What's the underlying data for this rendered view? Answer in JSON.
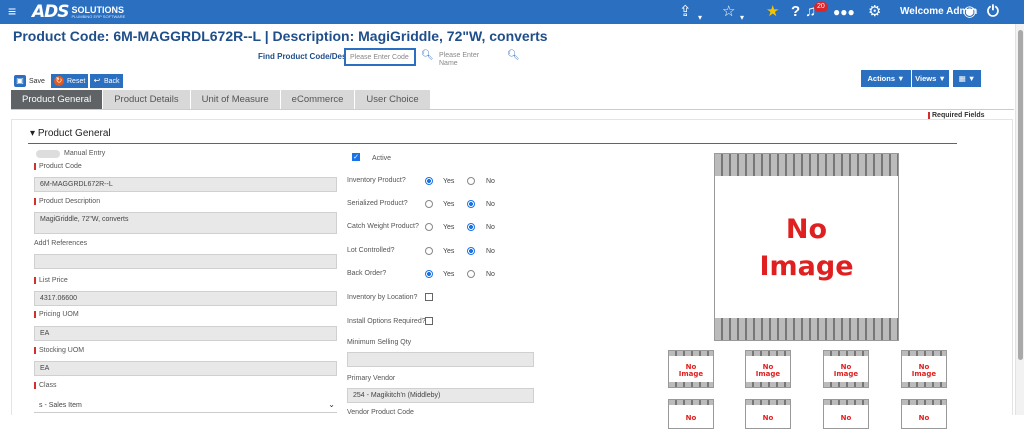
{
  "brand": {
    "logo_main": "ADS",
    "logo_sub": "SOLUTIONS",
    "logo_tag": "PLUMBING ERP SOFTWARE"
  },
  "topbar": {
    "notif_count": "20",
    "welcome": "Welcome Admin"
  },
  "icons": {
    "menu": "hamburger-icon",
    "share": "share-icon",
    "favorite": "star-outline-icon",
    "starred": "star-filled-icon",
    "help": "question-icon",
    "bell": "bell-icon",
    "users": "users-icon",
    "settings": "gear-icon",
    "user": "user-circle-icon",
    "power": "power-icon",
    "search": "search-icon",
    "save": "floppy-icon",
    "reset": "reset-icon",
    "back": "back-icon",
    "chevron": "chevron-down-icon"
  },
  "colors": {
    "brand": "#2a6fc0",
    "title": "#1f4e8a",
    "required": "#d32f2f",
    "active_tab": "#5f6365",
    "no_image": "#e02020"
  },
  "header": {
    "title": "Product Code:  6M-MAGGRDL672R--L | Description: MagiGriddle, 72\"W, converts"
  },
  "find": {
    "label": "Find Product Code/Desc",
    "code_placeholder": "Please Enter Code",
    "name_placeholder": "Please Enter Name"
  },
  "toolbar": {
    "save": "Save",
    "reset": "Reset",
    "back": "Back",
    "actions": "Actions ▼",
    "views": "Views ▼",
    "grid": "▦ ▼"
  },
  "tabs": [
    "Product General",
    "Product Details",
    "Unit of Measure",
    "eCommerce",
    "User Choice"
  ],
  "required_note": "Required Fields",
  "section": {
    "title": "Product General"
  },
  "left": {
    "manual_entry": "Manual Entry",
    "product_code_label": "Product Code",
    "product_code": "6M-MAGGRDL672R--L",
    "product_desc_label": "Product Description",
    "product_desc": "MagiGriddle, 72\"W, converts",
    "addl_ref_label": "Add'l References",
    "addl_ref": "",
    "list_price_label": "List Price",
    "list_price": "4317.06600",
    "pricing_uom_label": "Pricing UOM",
    "pricing_uom": "EA",
    "stocking_uom_label": "Stocking UOM",
    "stocking_uom": "EA",
    "class_label": "Class",
    "class_value": "s - Sales Item"
  },
  "mid": {
    "active": "Active",
    "yes": "Yes",
    "no": "No",
    "inventory": "Inventory Product?",
    "serialized": "Serialized Product?",
    "catch_weight": "Catch Weight Product?",
    "lot": "Lot Controlled?",
    "back_order": "Back Order?",
    "inv_by_loc": "Inventory by Location?",
    "install_opt": "Install Options Required?",
    "min_qty_label": "Minimum Selling Qty",
    "min_qty": "",
    "vendor_label": "Primary Vendor",
    "vendor": "254 - Magikitch'n (Middleby)",
    "vendor_code_label": "Vendor Product Code"
  },
  "image": {
    "line1": "No",
    "line2": "Image"
  }
}
